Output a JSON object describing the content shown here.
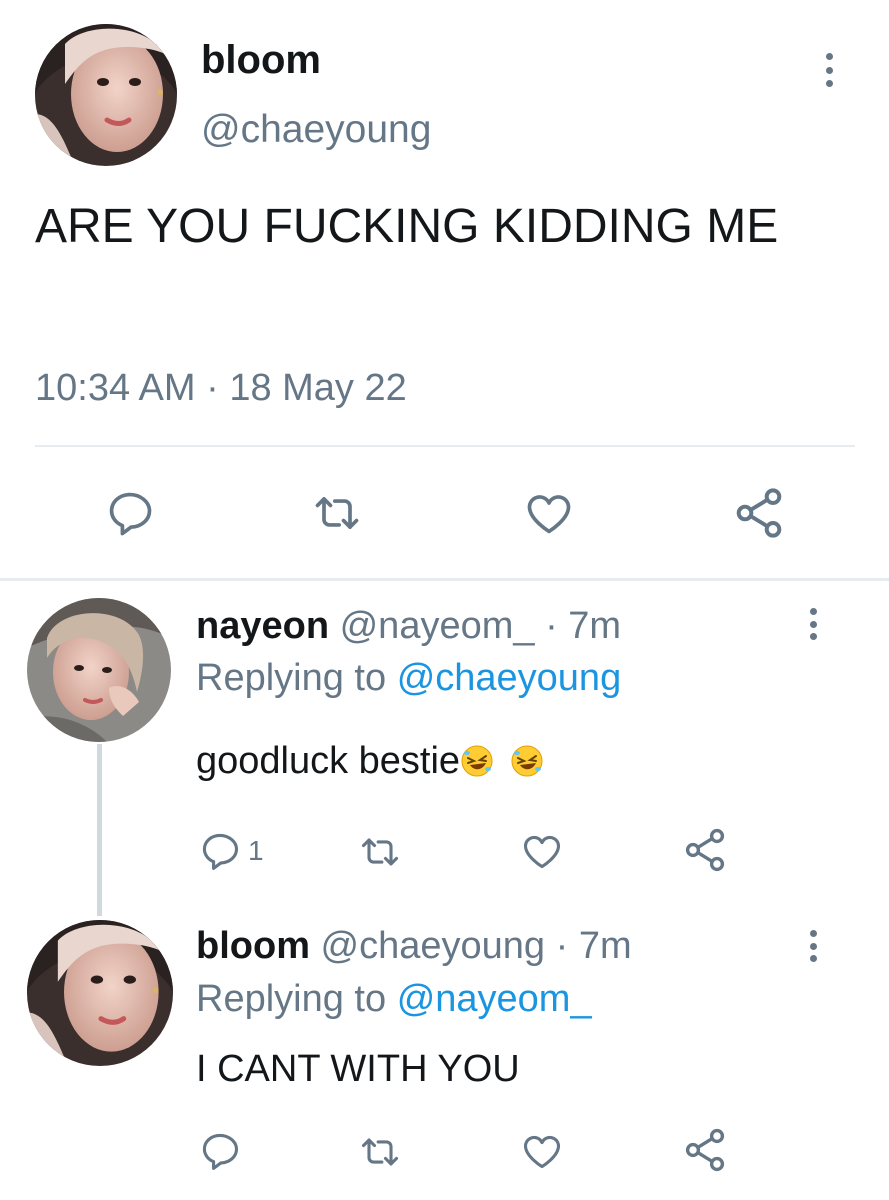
{
  "main_tweet": {
    "display_name": "bloom",
    "handle": "@chaeyoung",
    "text": "ARE YOU FUCKING KIDDING ME",
    "timestamp": "10:34 AM · 18 May 22",
    "actions": [
      "reply-icon",
      "retweet-icon",
      "like-icon",
      "share-icon"
    ]
  },
  "replies": [
    {
      "display_name": "nayeon",
      "handle": "@nayeom_",
      "time": "· 7m",
      "replying_label": "Replying to",
      "replying_to": "@chaeyoung",
      "text": "goodluck bestie",
      "emojis": [
        "rolling-on-floor-laughing",
        "rolling-on-floor-laughing"
      ],
      "reply_count": "1"
    },
    {
      "display_name": "bloom",
      "handle": "@chaeyoung",
      "time": "· 7m",
      "replying_label": "Replying to",
      "replying_to": "@nayeom_",
      "text": "I CANT WITH YOU"
    }
  ],
  "colors": {
    "text": "#14171a",
    "secondary": "#657786",
    "link": "#1b95e0",
    "divider": "#e6ecf0"
  }
}
